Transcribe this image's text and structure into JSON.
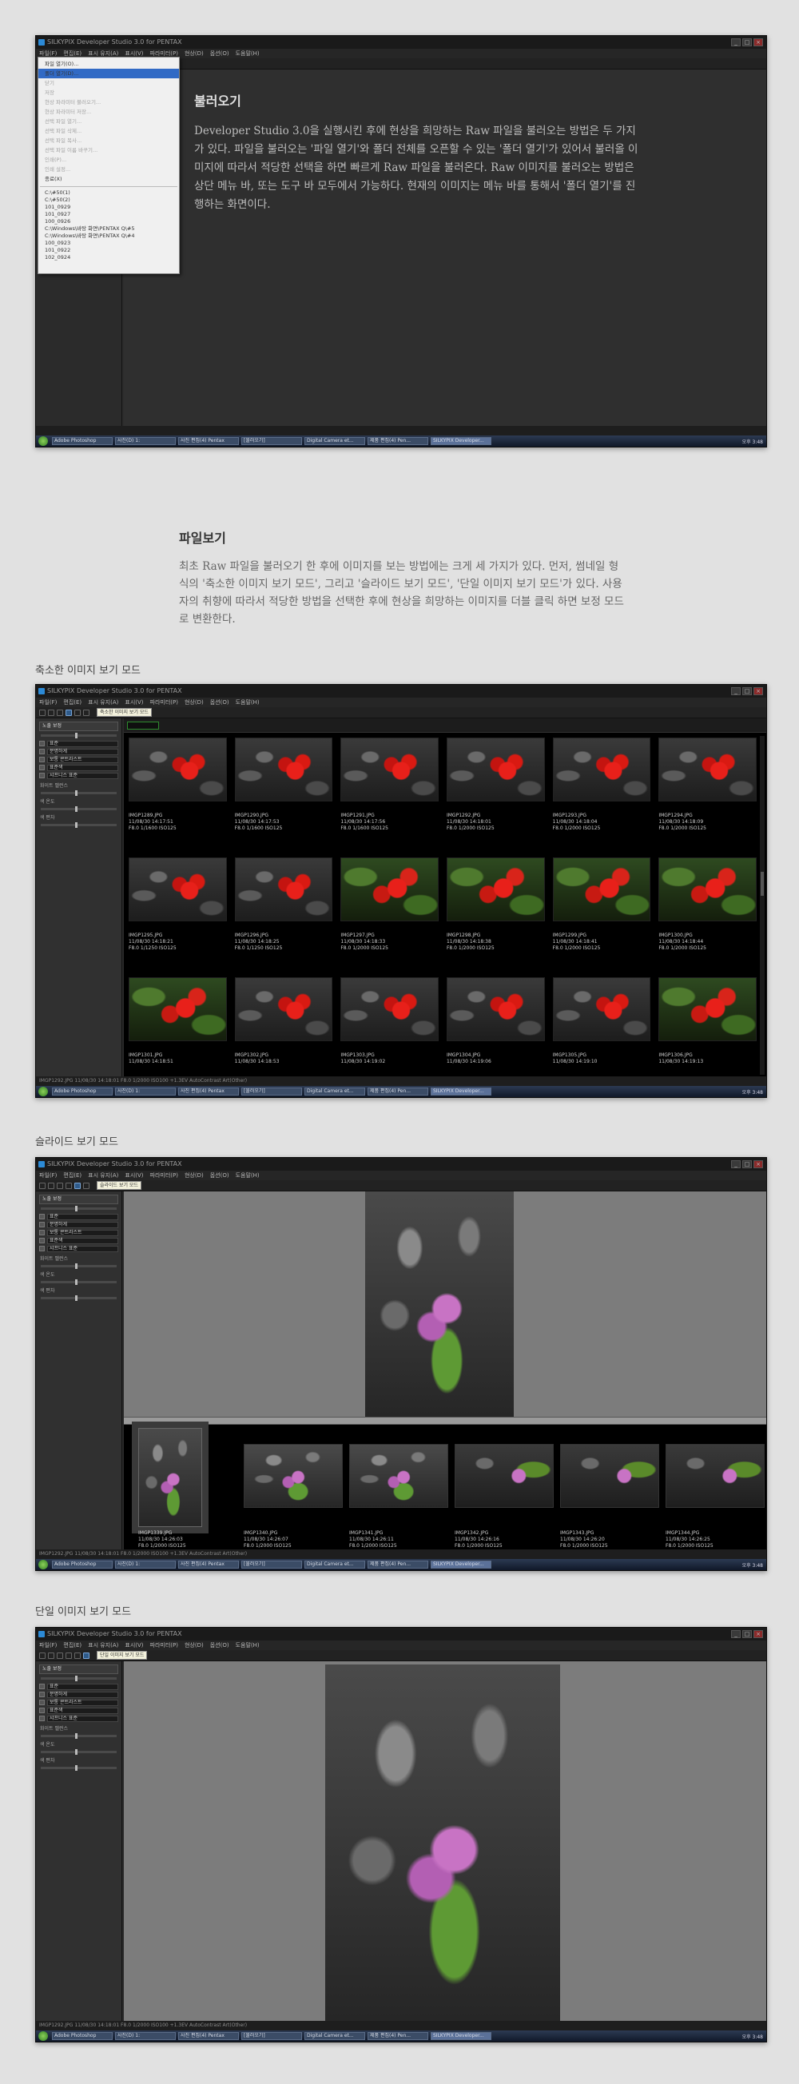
{
  "app": {
    "window_title": "SILKYPIX Developer Studio 3.0 for PENTAX",
    "menu": [
      "파일(F)",
      "편집(E)",
      "표시 유지(A)",
      "표시(V)",
      "파라미터(P)",
      "현상(D)",
      "옵션(O)",
      "도움말(H)"
    ],
    "taskbar_items": [
      "Adobe Photoshop",
      "사진(D) 1:",
      "사진 편집(4) Pentax",
      "[불러오기]",
      "Digital Camera et...",
      "제품 편집(4) Pen...",
      "SILKYPIX Developer..."
    ],
    "clock": "오후 3:48",
    "statusbar_text": "IMGP1292.JPG 11/08/30 14:18:01 F8.0 1/2000 ISO100 +1.3EV AutoContrast Art(Other)"
  },
  "section1": {
    "title": "불러오기",
    "body": "Developer Studio 3.0을 실행시킨 후에 현상을 희망하는 Raw 파일을 불러오는 방법은 두 가지가 있다. 파일을 불러오는 '파일 열기'와 폴더 전체를 오픈할 수 있는 '폴더 열기'가 있어서 불러올 이미지에 따라서 적당한 선택을 하면 빠르게 Raw 파일을 불러온다. Raw 이미지를 불러오는 방법은 상단 메뉴 바, 또는 도구 바 모두에서 가능하다. 현재의 이미지는 메뉴 바를 통해서 '폴더 열기'를 진행하는 화면이다.",
    "file_menu_items": [
      "파일 열기(O)...",
      "폴더 열기(D)...",
      "닫기",
      "저장",
      "현상 파라미터 불러오기...",
      "현상 파라미터 저장...",
      "선택 파일 열기...",
      "선택 파일 삭제...",
      "선택 파일 복사...",
      "선택 파일 이름 바꾸기...",
      "인쇄(P)...",
      "인쇄 설정...",
      "종료(X)"
    ],
    "recent_folders": [
      "C:\\#50(1)",
      "C:\\#50(2)",
      "101_0929",
      "101_0927",
      "100_0926",
      "C:\\Windows\\바탕 화면\\PENTAX Q\\#5",
      "C:\\Windows\\바탕 화면\\PENTAX Q\\#4",
      "100_0923",
      "101_0922",
      "102_0924"
    ]
  },
  "section2": {
    "title": "파일보기",
    "body": "최초 Raw 파일을 불러오기 한 후에 이미지를 보는 방법에는 크게 세 가지가 있다. 먼저, 썸네일 형식의 '축소한 이미지 보기 모드', 그리고 '슬라이드 보기 모드', '단일 이미지 보기 모드'가 있다. 사용자의 취향에 따라서 적당한 방법을 선택한 후에 현상을 희망하는 이미지를 더블 클릭 하면 보정 모드로 변환한다."
  },
  "mode1": {
    "label": "축소한 이미지 보기 모드",
    "tooltip": "축소한 이미지 보기 모드",
    "thumbs": [
      {
        "cap": "IMGP1289.JPG\n11/08/30 14:17:51\nF8.0 1/1600 ISO125"
      },
      {
        "cap": "IMGP1290.JPG\n11/08/30 14:17:53\nF8.0 1/1600 ISO125"
      },
      {
        "cap": "IMGP1291.JPG\n11/08/30 14:17:56\nF8.0 1/1600 ISO125"
      },
      {
        "cap": "IMGP1292.JPG\n11/08/30 14:18:01\nF8.0 1/2000 ISO125"
      },
      {
        "cap": "IMGP1293.JPG\n11/08/30 14:18:04\nF8.0 1/2000 ISO125"
      },
      {
        "cap": "IMGP1294.JPG\n11/08/30 14:18:09\nF8.0 1/2000 ISO125"
      },
      {
        "cap": "IMGP1295.JPG\n11/08/30 14:18:21\nF8.0 1/1250 ISO125"
      },
      {
        "cap": "IMGP1296.JPG\n11/08/30 14:18:25\nF8.0 1/1250 ISO125"
      },
      {
        "cap": "IMGP1297.JPG\n11/08/30 14:18:33\nF8.0 1/2000 ISO125"
      },
      {
        "cap": "IMGP1298.JPG\n11/08/30 14:18:38\nF8.0 1/2000 ISO125"
      },
      {
        "cap": "IMGP1299.JPG\n11/08/30 14:18:41\nF8.0 1/2000 ISO125"
      },
      {
        "cap": "IMGP1300.JPG\n11/08/30 14:18:44\nF8.0 1/2000 ISO125"
      },
      {
        "cap": "IMGP1301.JPG\n11/08/30 14:18:51"
      },
      {
        "cap": "IMGP1302.JPG\n11/08/30 14:18:53"
      },
      {
        "cap": "IMGP1303.JPG\n11/08/30 14:19:02"
      },
      {
        "cap": "IMGP1304.JPG\n11/08/30 14:19:06"
      },
      {
        "cap": "IMGP1305.JPG\n11/08/30 14:19:10"
      },
      {
        "cap": "IMGP1306.JPG\n11/08/30 14:19:13"
      }
    ]
  },
  "mode2": {
    "label": "슬라이드 보기 모드",
    "tooltip": "슬라이드 보기 모드",
    "strip": [
      {
        "cap": "IMGP1339.JPG\n11/08/30 14:26:03\nF8.0 1/2000 ISO125"
      },
      {
        "cap": "IMGP1340.JPG\n11/08/30 14:26:07\nF8.0 1/2000 ISO125"
      },
      {
        "cap": "IMGP1341.JPG\n11/08/30 14:26:11\nF8.0 1/2000 ISO125"
      },
      {
        "cap": "IMGP1342.JPG\n11/08/30 14:26:16\nF8.0 1/2000 ISO125"
      },
      {
        "cap": "IMGP1343.JPG\n11/08/30 14:26:20\nF8.0 1/2000 ISO125"
      },
      {
        "cap": "IMGP1344.JPG\n11/08/30 14:26:25\nF8.0 1/2000 ISO125"
      }
    ]
  },
  "mode3": {
    "label": "단일 이미지 보기 모드",
    "tooltip": "단일 이미지 보기 모드"
  },
  "panel": {
    "exposure_label": "노출 보정",
    "items": [
      "표준",
      "분명하게",
      "보통 콘트라스트",
      "표준색",
      "샤프니스 표준"
    ],
    "wb_label": "화이트 밸런스",
    "color_label": "색 온도",
    "tint_label": "색 편차",
    "sat_label": "하이라이트 컨트롤"
  }
}
